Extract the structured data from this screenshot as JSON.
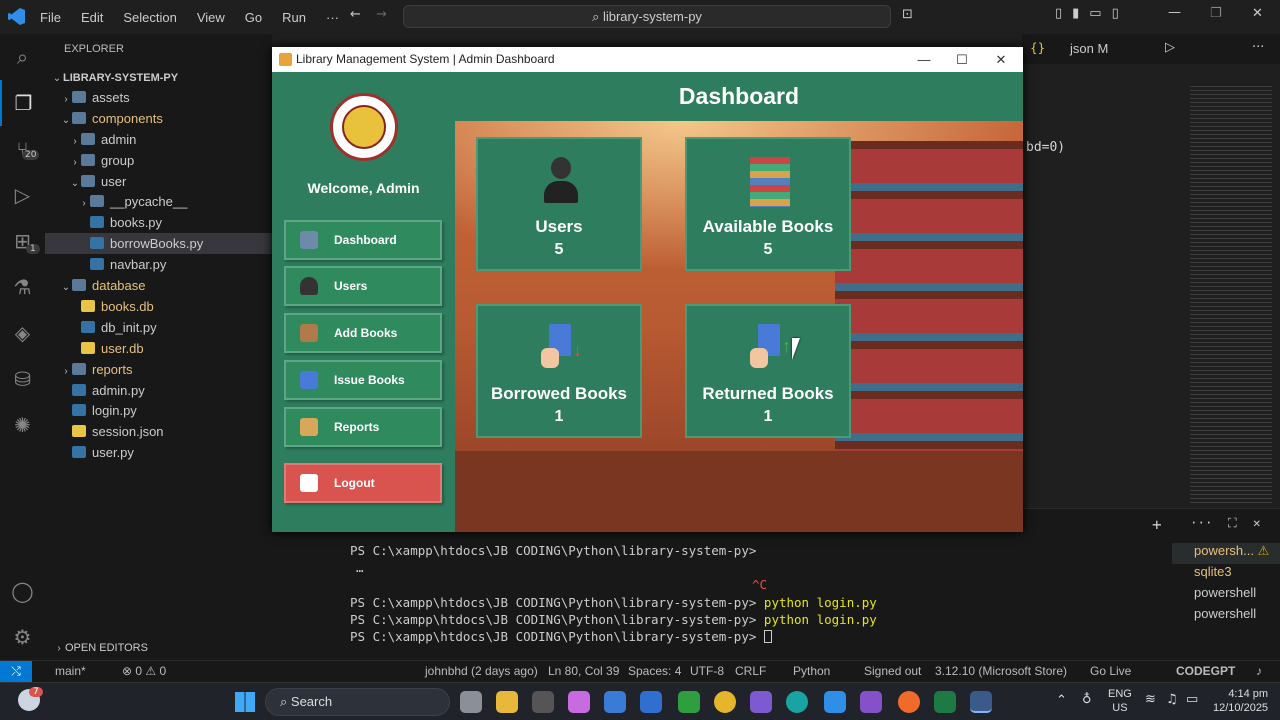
{
  "vscode": {
    "menu": [
      "File",
      "Edit",
      "Selection",
      "View",
      "Go",
      "Run",
      "···"
    ],
    "search": "library-system-py",
    "explorer_title": "EXPLORER",
    "activity_badges": {
      "source_control": "20",
      "extensions": "1"
    },
    "tree": [
      {
        "label": "LIBRARY-SYSTEM-PY",
        "depth": 0,
        "kind": "root",
        "open": true
      },
      {
        "label": "assets",
        "depth": 1,
        "kind": "folder",
        "open": false
      },
      {
        "label": "components",
        "depth": 1,
        "kind": "folder",
        "open": true
      },
      {
        "label": "admin",
        "depth": 2,
        "kind": "folder",
        "open": false
      },
      {
        "label": "group",
        "depth": 2,
        "kind": "folder",
        "open": false
      },
      {
        "label": "user",
        "depth": 2,
        "kind": "folder",
        "open": true
      },
      {
        "label": "__pycache__",
        "depth": 3,
        "kind": "folder",
        "open": false
      },
      {
        "label": "books.py",
        "depth": 3,
        "kind": "py"
      },
      {
        "label": "borrowBooks.py",
        "depth": 3,
        "kind": "py",
        "selected": true
      },
      {
        "label": "navbar.py",
        "depth": 3,
        "kind": "py"
      },
      {
        "label": "database",
        "depth": 1,
        "kind": "folder",
        "open": true
      },
      {
        "label": "books.db",
        "depth": 2,
        "kind": "db"
      },
      {
        "label": "db_init.py",
        "depth": 2,
        "kind": "py"
      },
      {
        "label": "user.db",
        "depth": 2,
        "kind": "db"
      },
      {
        "label": "reports",
        "depth": 1,
        "kind": "folder",
        "open": false
      },
      {
        "label": "admin.py",
        "depth": 1,
        "kind": "py"
      },
      {
        "label": "login.py",
        "depth": 1,
        "kind": "py"
      },
      {
        "label": "session.json",
        "depth": 1,
        "kind": "json"
      },
      {
        "label": "user.py",
        "depth": 1,
        "kind": "py"
      }
    ],
    "open_editors": "OPEN EDITORS",
    "tab_visible": "json M",
    "code_snippet": "bd=0)",
    "terminal": {
      "lines": [
        "PS C:\\xampp\\htdocs\\JB CODING\\Python\\library-system-py>",
        "…",
        "^C",
        "PS C:\\xampp\\htdocs\\JB CODING\\Python\\library-system-py>",
        "PS C:\\xampp\\htdocs\\JB CODING\\Python\\library-system-py>",
        "PS C:\\xampp\\htdocs\\JB CODING\\Python\\library-system-py>"
      ],
      "cmds": [
        "python login.py",
        "python login.py"
      ],
      "list": [
        "powersh...",
        "sqlite3",
        "powershell",
        "powershell"
      ]
    },
    "status": {
      "branch": "main*",
      "problems": "⊗ 0 ⚠ 0",
      "blame": "johnbhd (2 days ago)",
      "position": "Ln 80, Col 39",
      "spaces": "Spaces: 4",
      "encoding": "UTF-8",
      "eol": "CRLF",
      "language": "Python",
      "signed": "Signed out",
      "interpreter": "3.12.10 (Microsoft Store)",
      "golive": "Go Live",
      "codegpt": "CODEGPT"
    }
  },
  "app": {
    "window_title": "Library Management System | Admin Dashboard",
    "heading": "Dashboard",
    "welcome": "Welcome, Admin",
    "nav": [
      {
        "label": "Dashboard",
        "icon": "book-stack-icon"
      },
      {
        "label": "Users",
        "icon": "user-icon"
      },
      {
        "label": "Add Books",
        "icon": "add-books-icon"
      },
      {
        "label": "Issue Books",
        "icon": "issue-books-icon"
      },
      {
        "label": "Reports",
        "icon": "reports-icon"
      }
    ],
    "logout": "Logout",
    "cards": [
      {
        "title": "Users",
        "value": "5"
      },
      {
        "title": "Available Books",
        "value": "5"
      },
      {
        "title": "Borrowed Books",
        "value": "1"
      },
      {
        "title": "Returned Books",
        "value": "1"
      }
    ]
  },
  "taskbar": {
    "search": "Search",
    "lang": "ENG",
    "region": "US",
    "time": "4:14 pm",
    "date": "12/10/2025",
    "badge": "7"
  }
}
